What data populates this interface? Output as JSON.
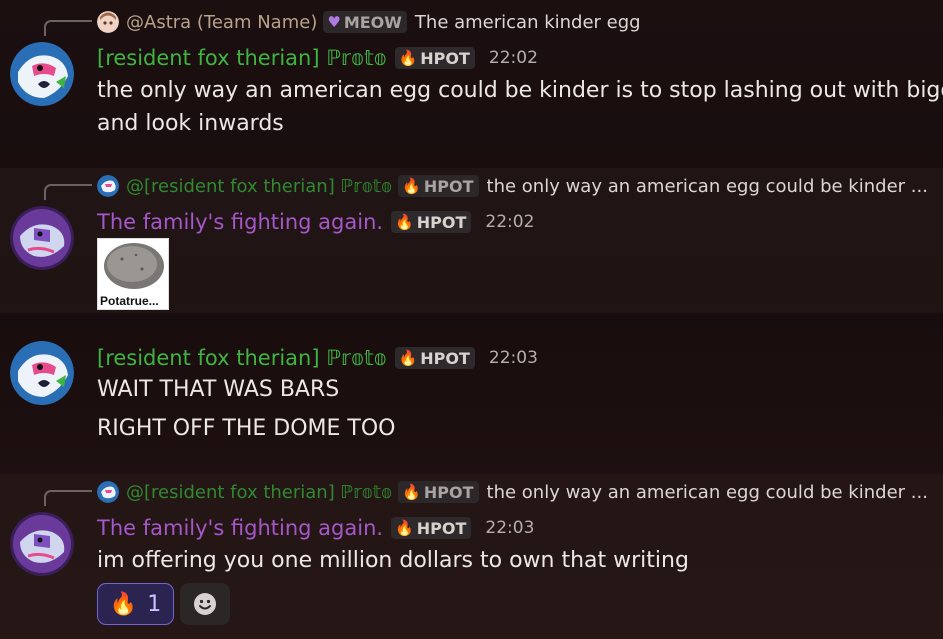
{
  "messages": [
    {
      "reply": {
        "name": "@Astra (Team Name)",
        "tag": {
          "icon": "purple-heart-icon",
          "label": "MEOW"
        },
        "text": "The american kinder egg",
        "color": "#b7a38a"
      },
      "author": {
        "name": "[resident fox therian] ℙ𝕣𝕠𝕥𝕠",
        "color": "#3fb541"
      },
      "tag": {
        "icon": "fire-icon",
        "label": "HPOT"
      },
      "time": "22:02",
      "lines": [
        "the only way an american egg could be kinder is to stop lashing out with bigotry",
        "and look inwards"
      ]
    },
    {
      "reply": {
        "name": "@[resident fox therian] ℙ𝕣𝕠𝕥𝕠",
        "tag": {
          "icon": "fire-icon",
          "label": "HPOT"
        },
        "text": "the only way an american egg could be kinder ...",
        "color": "#2f8a30"
      },
      "author": {
        "name": "The family's fighting again.",
        "color": "#a657c9"
      },
      "tag": {
        "icon": "fire-icon",
        "label": "HPOT"
      },
      "time": "22:02",
      "attachment": {
        "caption": "Potatrue..."
      }
    },
    {
      "author": {
        "name": "[resident fox therian] ℙ𝕣𝕠𝕥𝕠",
        "color": "#3fb541"
      },
      "tag": {
        "icon": "fire-icon",
        "label": "HPOT"
      },
      "time": "22:03",
      "lines": [
        "WAIT THAT WAS BARS",
        "RIGHT OFF THE DOME TOO"
      ]
    },
    {
      "reply": {
        "name": "@[resident fox therian] ℙ𝕣𝕠𝕥𝕠",
        "tag": {
          "icon": "fire-icon",
          "label": "HPOT"
        },
        "text": "the only way an american egg could be kinder ...",
        "color": "#2f8a30"
      },
      "author": {
        "name": "The family's fighting again.",
        "color": "#a657c9"
      },
      "tag": {
        "icon": "fire-icon",
        "label": "HPOT"
      },
      "time": "22:03",
      "lines": [
        "im offering you one million dollars to own that writing"
      ],
      "reactions": [
        {
          "emoji": "🔥",
          "icon": "fire-emoji-icon",
          "count": "1"
        }
      ],
      "add_reaction_icon": "add-reaction-smiley-icon"
    }
  ]
}
